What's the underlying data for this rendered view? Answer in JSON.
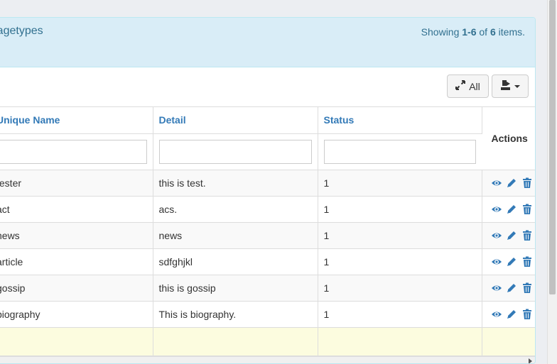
{
  "panel": {
    "title": "Pagetypes",
    "summary": {
      "prefix": "Showing ",
      "range": "1-6",
      "of": " of ",
      "total": "6",
      "suffix": " items."
    }
  },
  "toolbar": {
    "all_label": "All",
    "all_icon": "resize-full-icon",
    "export_icon": "export-icon"
  },
  "table": {
    "columns": [
      {
        "label": "Unique Name"
      },
      {
        "label": "Detail"
      },
      {
        "label": "Status"
      }
    ],
    "actions_label": "Actions",
    "rows": [
      {
        "name": "tester",
        "detail": "this is test.",
        "status": "1"
      },
      {
        "name": "act",
        "detail": "acs.",
        "status": "1"
      },
      {
        "name": "news",
        "detail": "news",
        "status": "1"
      },
      {
        "name": "article",
        "detail": "sdfghjkl",
        "status": "1"
      },
      {
        "name": "gossip",
        "detail": "this is gossip",
        "status": "1"
      },
      {
        "name": "biography",
        "detail": "This is biography.",
        "status": "1"
      }
    ],
    "row_action_icons": [
      "eye-icon",
      "pencil-icon",
      "trash-icon"
    ]
  },
  "colors": {
    "link": "#337ab7",
    "info_bg": "#d9edf7",
    "info_text": "#31708f",
    "footer_bg": "#fcfcdf"
  }
}
